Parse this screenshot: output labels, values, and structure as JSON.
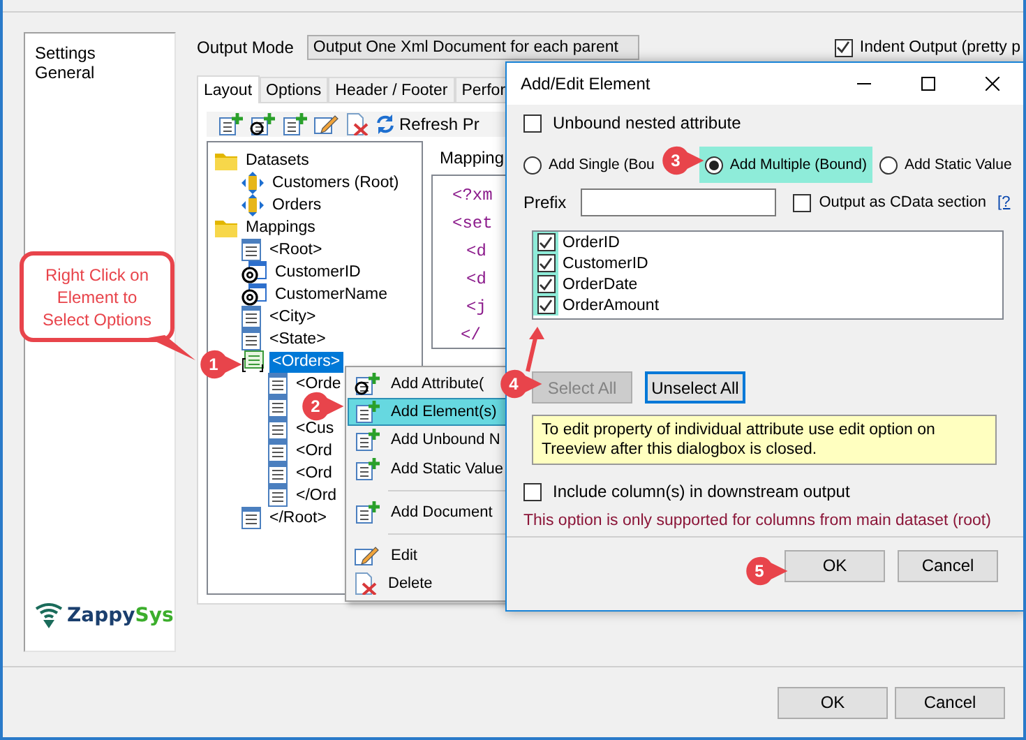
{
  "sidebar": {
    "items": [
      "Settings",
      "General"
    ]
  },
  "logo": [
    "Zappy",
    "Sys"
  ],
  "output_mode": {
    "label": "Output Mode",
    "value": "Output One Xml Document for each parent"
  },
  "indent_output": {
    "label": "Indent Output (pretty p",
    "checked": true
  },
  "tabs": [
    {
      "label": "Layout",
      "selected": true
    },
    {
      "label": "Options",
      "selected": false
    },
    {
      "label": "Header / Footer",
      "selected": false
    },
    {
      "label": "Perfor",
      "selected": false
    }
  ],
  "toolbar": {
    "refresh": "Refresh Pr"
  },
  "tree": [
    {
      "label": "Datasets",
      "kind": "folder",
      "selected": false,
      "children": [
        {
          "label": "Customers (Root)",
          "kind": "dataset",
          "selected": false
        },
        {
          "label": "Orders",
          "kind": "dataset",
          "selected": false
        }
      ]
    },
    {
      "label": "Mappings",
      "kind": "folder",
      "selected": false,
      "children": [
        {
          "label": "<Root>",
          "kind": "element",
          "selected": false
        },
        {
          "label": "CustomerID",
          "kind": "attribute",
          "selected": false
        },
        {
          "label": "CustomerName",
          "kind": "attribute",
          "selected": false
        },
        {
          "label": "<City>",
          "kind": "element",
          "selected": false
        },
        {
          "label": "<State>",
          "kind": "element",
          "selected": false
        },
        {
          "label": "<Orders>",
          "kind": "array",
          "selected": true,
          "children": [
            {
              "label": "<Orde",
              "kind": "element",
              "selected": false
            },
            {
              "kind": "element",
              "selected": false
            },
            {
              "label": "<Cus",
              "kind": "element",
              "selected": false
            },
            {
              "label": "<Ord",
              "kind": "element",
              "selected": false
            },
            {
              "label": "<Ord",
              "kind": "element",
              "selected": false
            },
            {
              "label": "</Ord",
              "kind": "element",
              "selected": false
            }
          ]
        },
        {
          "label": "</Root>",
          "kind": "element",
          "selected": false
        }
      ]
    }
  ],
  "mapping": {
    "label": "Mapping",
    "code": [
      "<?xm",
      "<set",
      "<d",
      "<d",
      "<j",
      "</"
    ]
  },
  "context_menu": [
    {
      "kind": "item",
      "label": "Add Attribute(",
      "selected": false
    },
    {
      "kind": "item",
      "label": "Add Element(s)",
      "selected": true
    },
    {
      "kind": "item",
      "label": "Add Unbound N",
      "selected": false
    },
    {
      "kind": "item",
      "label": "Add Static Value",
      "selected": false
    },
    {
      "kind": "separator"
    },
    {
      "kind": "item",
      "label": "Add Document",
      "selected": false
    },
    {
      "kind": "separator"
    },
    {
      "kind": "item",
      "label": "Edit",
      "selected": false
    },
    {
      "kind": "item",
      "label": "Delete",
      "selected": false
    }
  ],
  "dialog": {
    "title": "Add/Edit Element",
    "unbound": {
      "label": "Unbound nested attribute",
      "checked": false
    },
    "modes": [
      {
        "label": "Add Single (Bou",
        "selected": false
      },
      {
        "label": "Add Multiple (Bound)",
        "selected": true
      },
      {
        "label": "Add Static Value",
        "selected": false
      }
    ],
    "prefix": {
      "label": "Prefix"
    },
    "cdata": {
      "label": "Output as CData section",
      "checked": false
    },
    "help_link": "[?",
    "columns": [
      {
        "label": "OrderID",
        "checked": true
      },
      {
        "label": "CustomerID",
        "checked": true
      },
      {
        "label": "OrderDate",
        "checked": true
      },
      {
        "label": "OrderAmount",
        "checked": true
      }
    ],
    "list_buttons": [
      {
        "label": "Select All",
        "disabled": true
      },
      {
        "label": "Unselect All",
        "disabled": false
      }
    ],
    "tip": "To edit property of individual attribute use edit option on Treeview after this dialogbox is closed.",
    "include": {
      "label": "Include column(s) in downstream output",
      "checked": false
    },
    "note": "This option is only supported for columns from main dataset (root)",
    "buttons": [
      "OK",
      "Cancel"
    ]
  },
  "buttons": [
    "OK",
    "Cancel"
  ],
  "annotations": {
    "callout": "Right Click on Element to Select Options",
    "badges": [
      "1",
      "2",
      "3",
      "4",
      "5"
    ]
  }
}
